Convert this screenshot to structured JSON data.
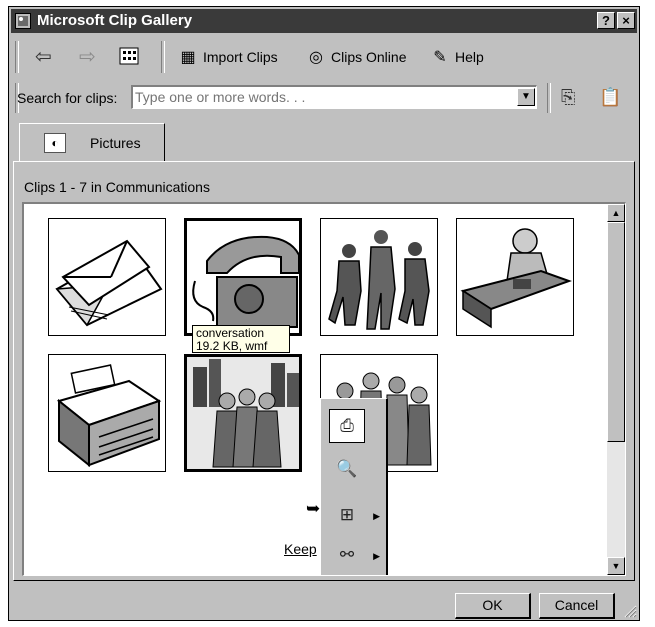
{
  "window": {
    "title": "Microsoft Clip Gallery"
  },
  "titlebar_buttons": {
    "help": "?",
    "close": "×"
  },
  "toolbar": {
    "back_icon": "back-arrow-icon",
    "forward_icon": "forward-arrow-icon",
    "view_icon": "all-categories-icon",
    "import": {
      "label": "Import Clips",
      "icon": "import-clips-icon"
    },
    "online": {
      "label": "Clips Online",
      "icon": "clips-online-icon"
    },
    "help": {
      "label": "Help",
      "icon": "help-icon"
    }
  },
  "search": {
    "label": "Search for clips:",
    "placeholder": "Type one or more words. . .",
    "value": ""
  },
  "tabs": [
    {
      "label": "Pictures"
    }
  ],
  "clips": {
    "header": "Clips 1 - 7 in Communications",
    "items": [
      {
        "name": "envelopes",
        "icon": "envelope-clip"
      },
      {
        "name": "telephone",
        "icon": "telephone-clip"
      },
      {
        "name": "people-talking",
        "icon": "people-clip"
      },
      {
        "name": "office-worker",
        "icon": "office-clip"
      },
      {
        "name": "typewriter",
        "icon": "typewriter-clip"
      },
      {
        "name": "conversation",
        "icon": "conversation-clip"
      },
      {
        "name": "crowd",
        "icon": "crowd-clip"
      }
    ]
  },
  "tooltip": {
    "line1": "conversation",
    "line2": "19.2 KB, wmf"
  },
  "popup_menu": [
    {
      "icon": "insert-clip-icon"
    },
    {
      "icon": "preview-clip-icon"
    },
    {
      "icon": "add-to-category-icon"
    },
    {
      "icon": "find-similar-icon"
    }
  ],
  "partial_text": {
    "keep": "Keep"
  },
  "buttons": {
    "ok": "OK",
    "cancel": "Cancel"
  }
}
